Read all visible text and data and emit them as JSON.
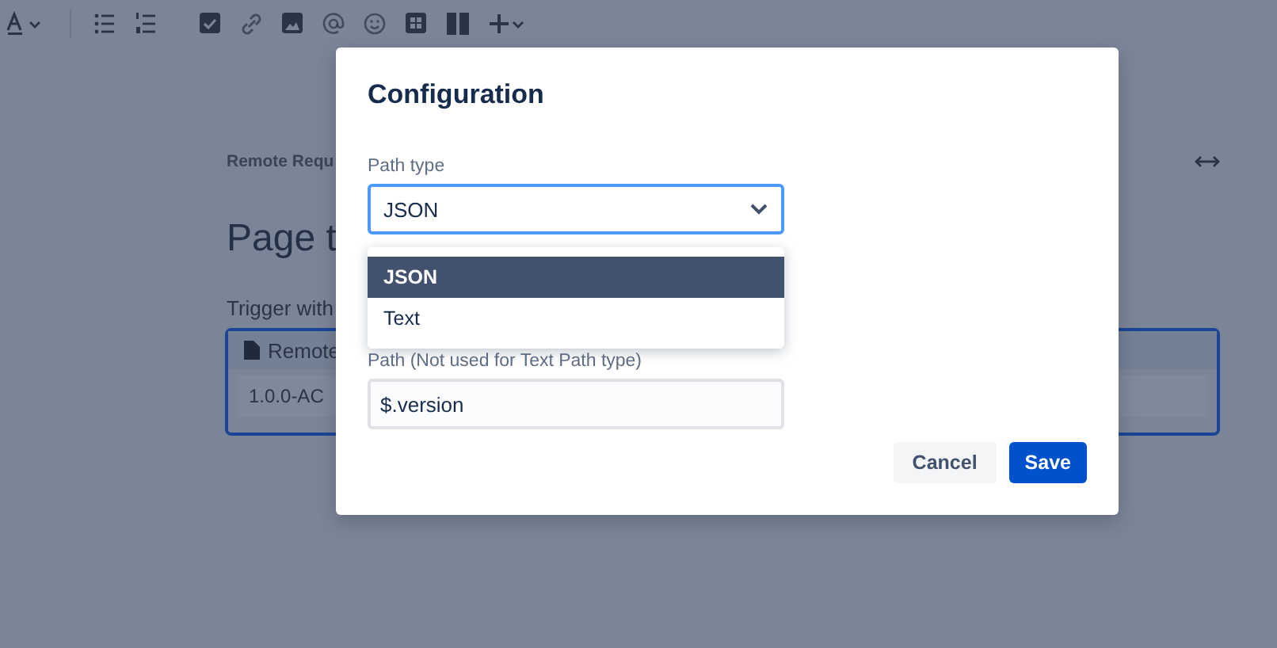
{
  "page": {
    "breadcrumb": "Remote Requ",
    "title": "Page t",
    "section_label": "Trigger with",
    "panel": {
      "header": "Remote",
      "value": "1.0.0-AC"
    }
  },
  "dialog": {
    "title": "Configuration",
    "fields": [
      {
        "kind": "select",
        "label": "Path type",
        "value": "JSON",
        "open": true,
        "options": [
          {
            "label": "JSON",
            "selected": true
          },
          {
            "label": "Text",
            "selected": false
          }
        ]
      },
      {
        "kind": "text",
        "label": "Path (Not used for Text Path type)",
        "value": "$.version"
      }
    ],
    "buttons": [
      {
        "label": "Cancel",
        "primary": false
      },
      {
        "label": "Save",
        "primary": true
      }
    ]
  }
}
